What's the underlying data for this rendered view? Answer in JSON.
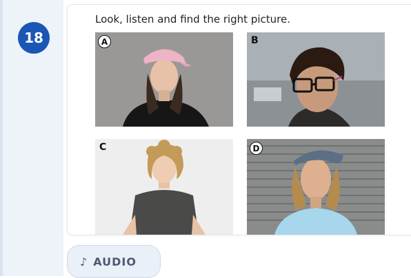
{
  "question": {
    "number": "18"
  },
  "instruction": "Look, listen and find the right picture.",
  "options": [
    {
      "letter": "A",
      "description": "Girl wearing a pink cap and black hoodie"
    },
    {
      "letter": "B",
      "description": "Boy with glasses and curly dark hair"
    },
    {
      "letter": "C",
      "description": "Boy with curly blond hair in grey t-shirt"
    },
    {
      "letter": "D",
      "description": "Young man with long hair and flat cap"
    }
  ],
  "audio": {
    "icon": "music-note-icon",
    "label": "AUDIO"
  },
  "colors": {
    "badge": "#1a56b5",
    "sidebar": "#eef3fa",
    "audio_bg": "#eaf0f8"
  }
}
